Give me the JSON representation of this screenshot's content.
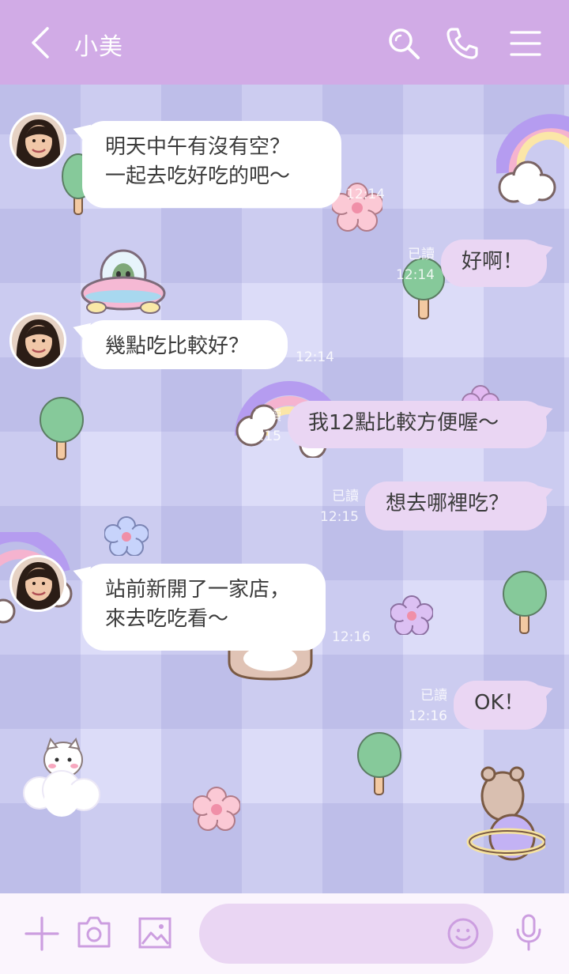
{
  "header": {
    "title": "小美",
    "back_icon": "chevron-left-icon",
    "search_icon": "search-icon",
    "call_icon": "phone-icon",
    "menu_icon": "menu-icon"
  },
  "theme": {
    "header_color": "#d1abe6",
    "outgoing_bubble_color": "#ead6f3",
    "incoming_bubble_color": "#ffffff",
    "chat_background": "#dcdcf8"
  },
  "messages": [
    {
      "direction": "incoming",
      "text": "明天中午有沒有空？\n一起去吃好吃的吧～",
      "time": "12:14"
    },
    {
      "direction": "outgoing",
      "text": "好啊！",
      "read": "已讀",
      "time": "12:14"
    },
    {
      "direction": "incoming",
      "text": "幾點吃比較好？",
      "time": "12:14"
    },
    {
      "direction": "outgoing",
      "text": "我12點比較方便喔～",
      "read": "已讀",
      "time": "12:15"
    },
    {
      "direction": "outgoing",
      "text": "想去哪裡吃？",
      "read": "已讀",
      "time": "12:15"
    },
    {
      "direction": "incoming",
      "text": "站前新開了一家店，\n來去吃吃看～",
      "time": "12:16"
    },
    {
      "direction": "outgoing",
      "text": "OK！",
      "read": "已讀",
      "time": "12:16"
    }
  ],
  "input_bar": {
    "plus_icon": "plus-icon",
    "camera_icon": "camera-icon",
    "image_icon": "image-icon",
    "message_placeholder": "",
    "emoji_icon": "smiley-icon",
    "mic_icon": "microphone-icon"
  }
}
